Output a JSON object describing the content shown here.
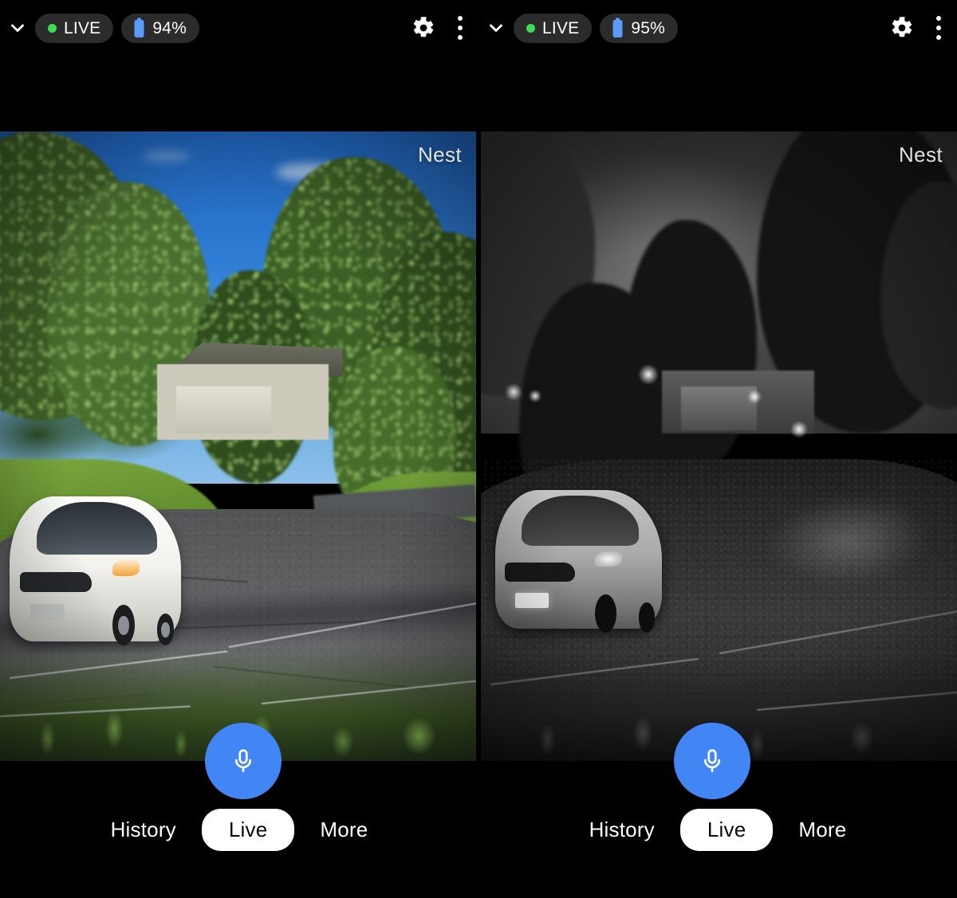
{
  "app": {
    "background_color": "#000000",
    "accent_color": "#4285f4",
    "live_dot_color": "#3ddc53",
    "battery_icon_color": "#5b9bf8",
    "chip_background": "#2b2b2b"
  },
  "cameras": [
    {
      "id": "camera-left",
      "collapse_label": "Collapse",
      "status_chip": {
        "label": "LIVE",
        "icon": "live-dot-icon"
      },
      "battery_chip": {
        "label": "94%",
        "icon": "battery-icon"
      },
      "settings_label": "Settings",
      "overflow_label": "More options",
      "watermark": "Nest",
      "mic_label": "Talk",
      "mic_icon": "microphone-icon",
      "scene": "daytime-driveway-with-white-car",
      "tabs": [
        {
          "label": "History",
          "active": false
        },
        {
          "label": "Live",
          "active": true
        },
        {
          "label": "More",
          "active": false
        }
      ]
    },
    {
      "id": "camera-right",
      "collapse_label": "Collapse",
      "status_chip": {
        "label": "LIVE",
        "icon": "live-dot-icon"
      },
      "battery_chip": {
        "label": "95%",
        "icon": "battery-icon"
      },
      "settings_label": "Settings",
      "overflow_label": "More options",
      "watermark": "Nest",
      "mic_label": "Talk",
      "mic_icon": "microphone-icon",
      "scene": "night-vision-driveway-with-car",
      "tabs": [
        {
          "label": "History",
          "active": false
        },
        {
          "label": "Live",
          "active": true
        },
        {
          "label": "More",
          "active": false
        }
      ]
    }
  ]
}
